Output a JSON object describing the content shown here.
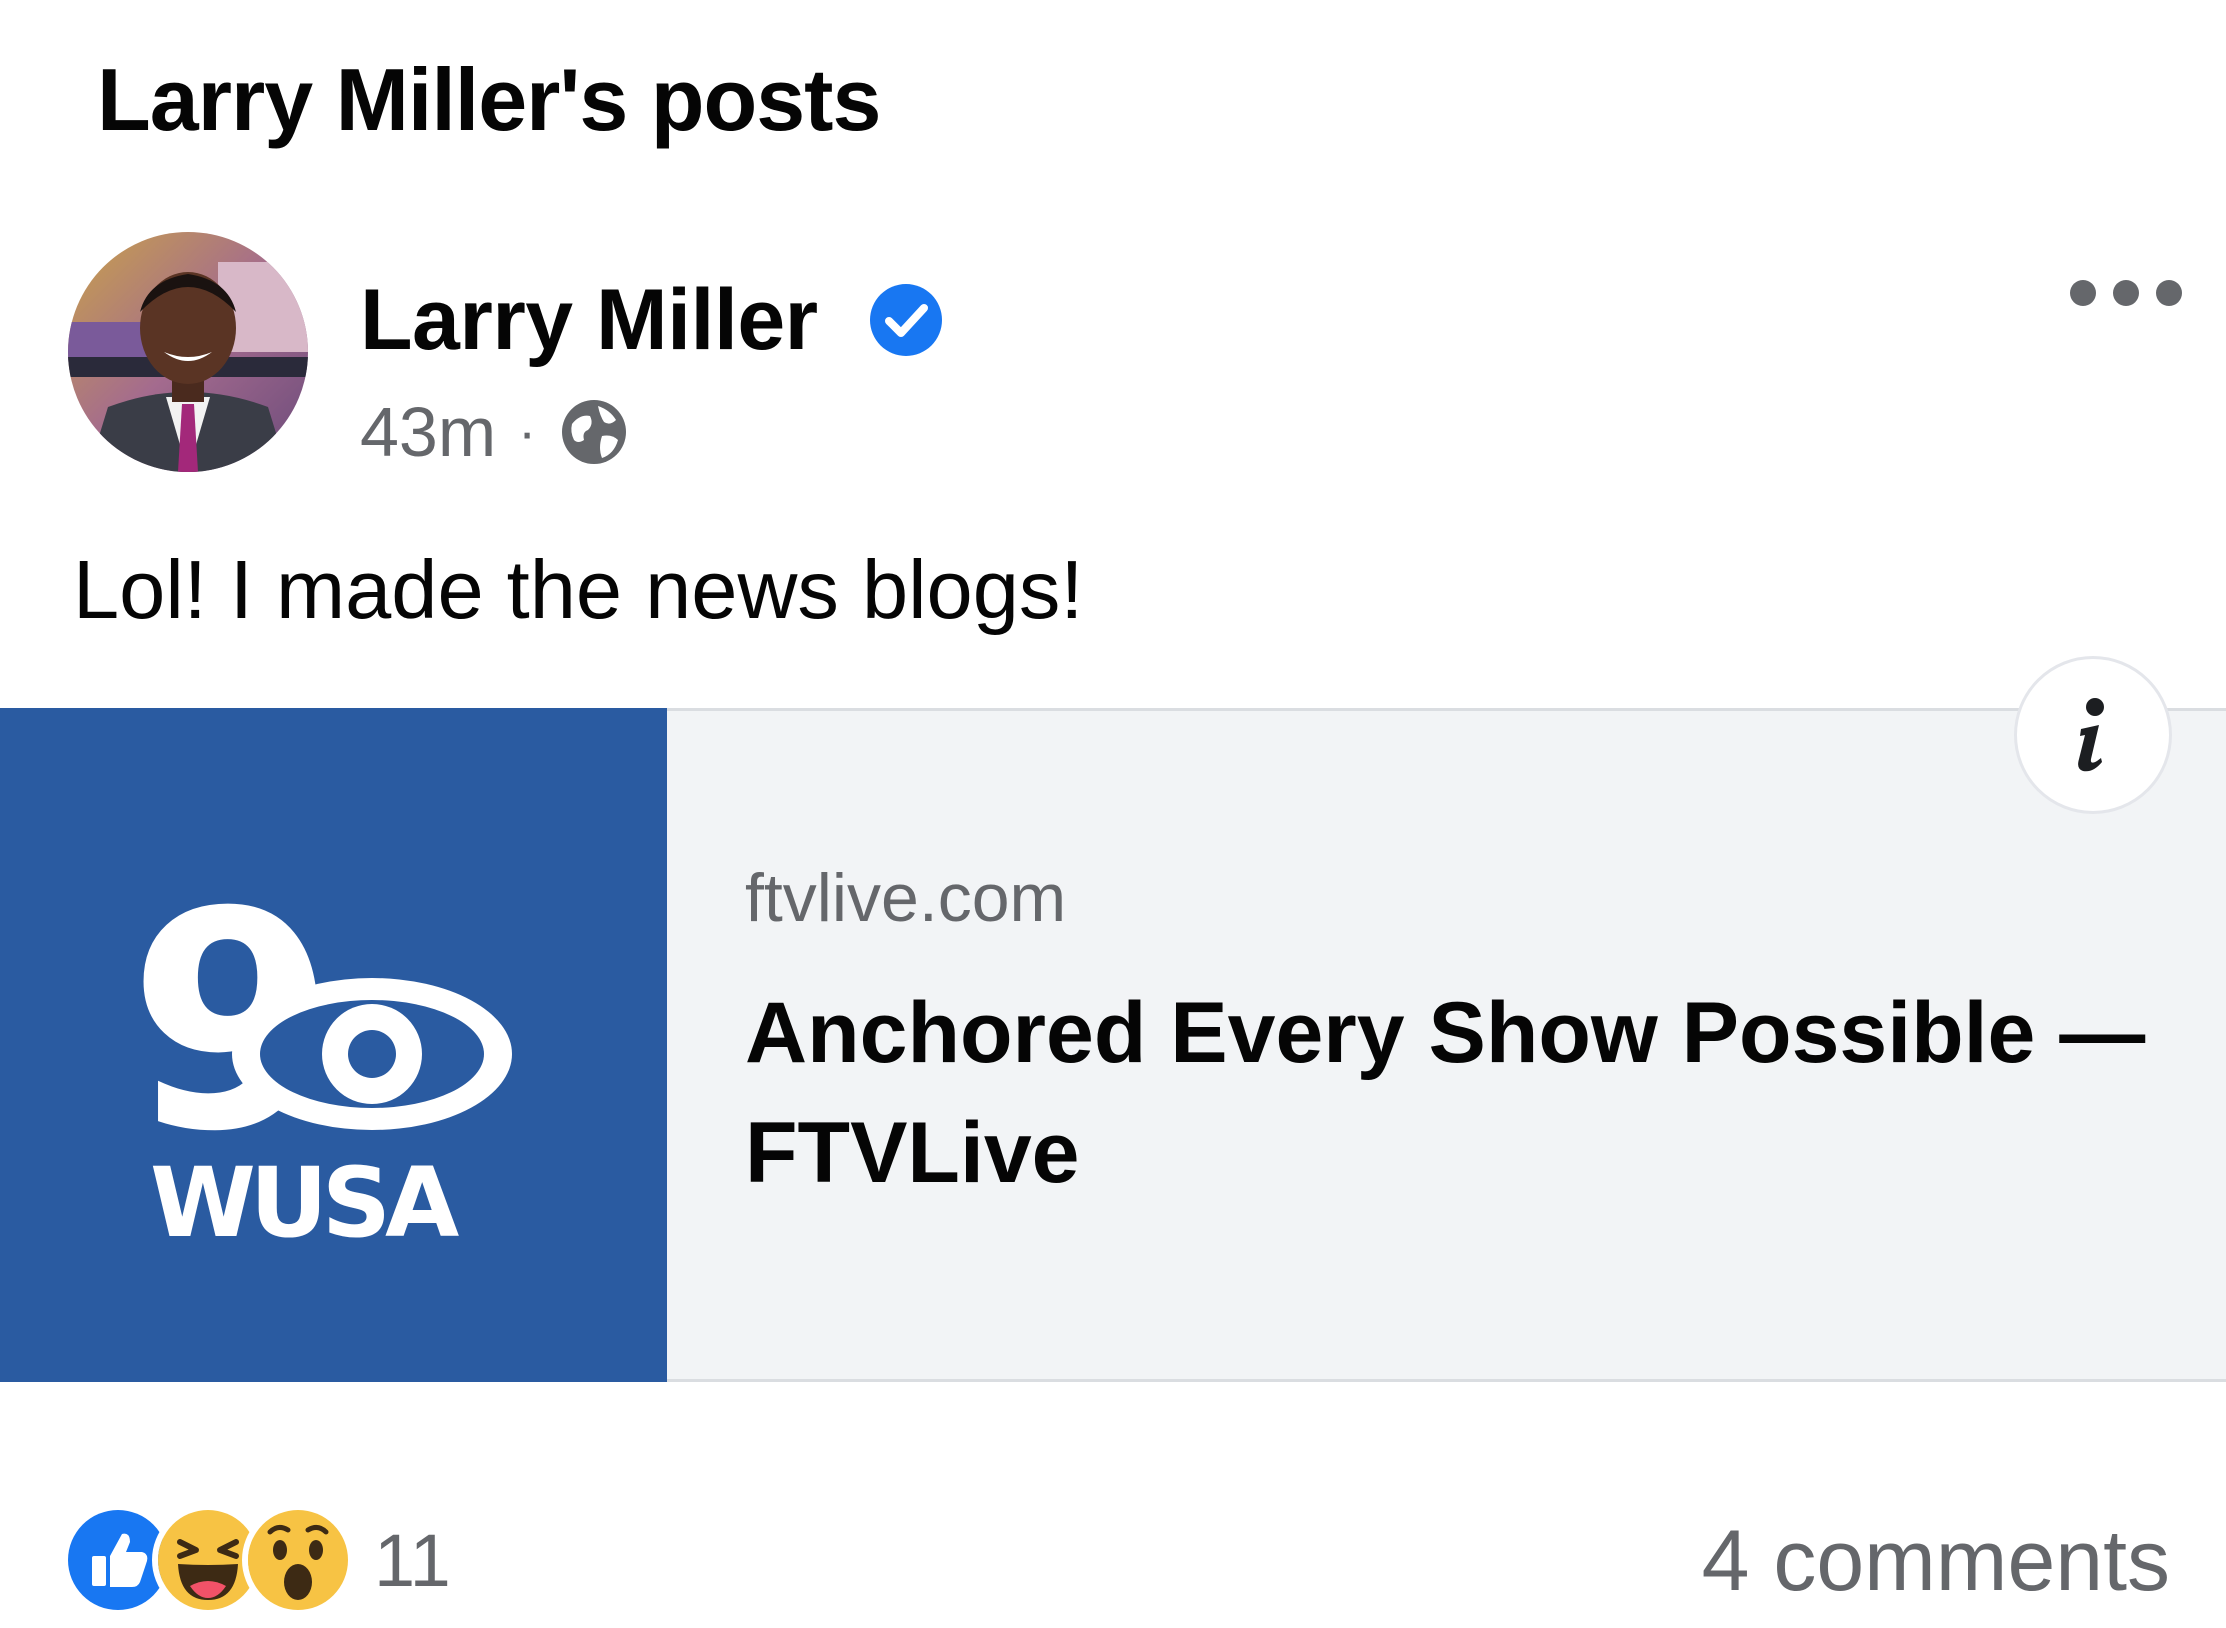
{
  "page": {
    "title": "Larry Miller's posts"
  },
  "post": {
    "author": "Larry Miller",
    "verified": true,
    "timestamp": "43m",
    "separator": "·",
    "audience_icon": "globe-icon",
    "text": "Lol! I made the news blogs!",
    "more_icon": "ellipsis-icon"
  },
  "link_preview": {
    "domain": "ftvlive.com",
    "title": "Anchored Every Show Possible — FTVLive",
    "thumbnail_logo": {
      "channel_number": "9",
      "call_letters": "WUSA"
    },
    "info_icon": "info-icon"
  },
  "engagement": {
    "reactions": [
      "like",
      "haha",
      "wow"
    ],
    "reaction_count": "11",
    "comments": "4 comments"
  },
  "colors": {
    "verified_blue": "#1877f2",
    "like_blue": "#1877f2",
    "emoji_yellow": "#f7c344",
    "thumbnail_blue": "#2a5ba1",
    "secondary_text": "#65676b",
    "card_background": "#f2f4f6"
  }
}
